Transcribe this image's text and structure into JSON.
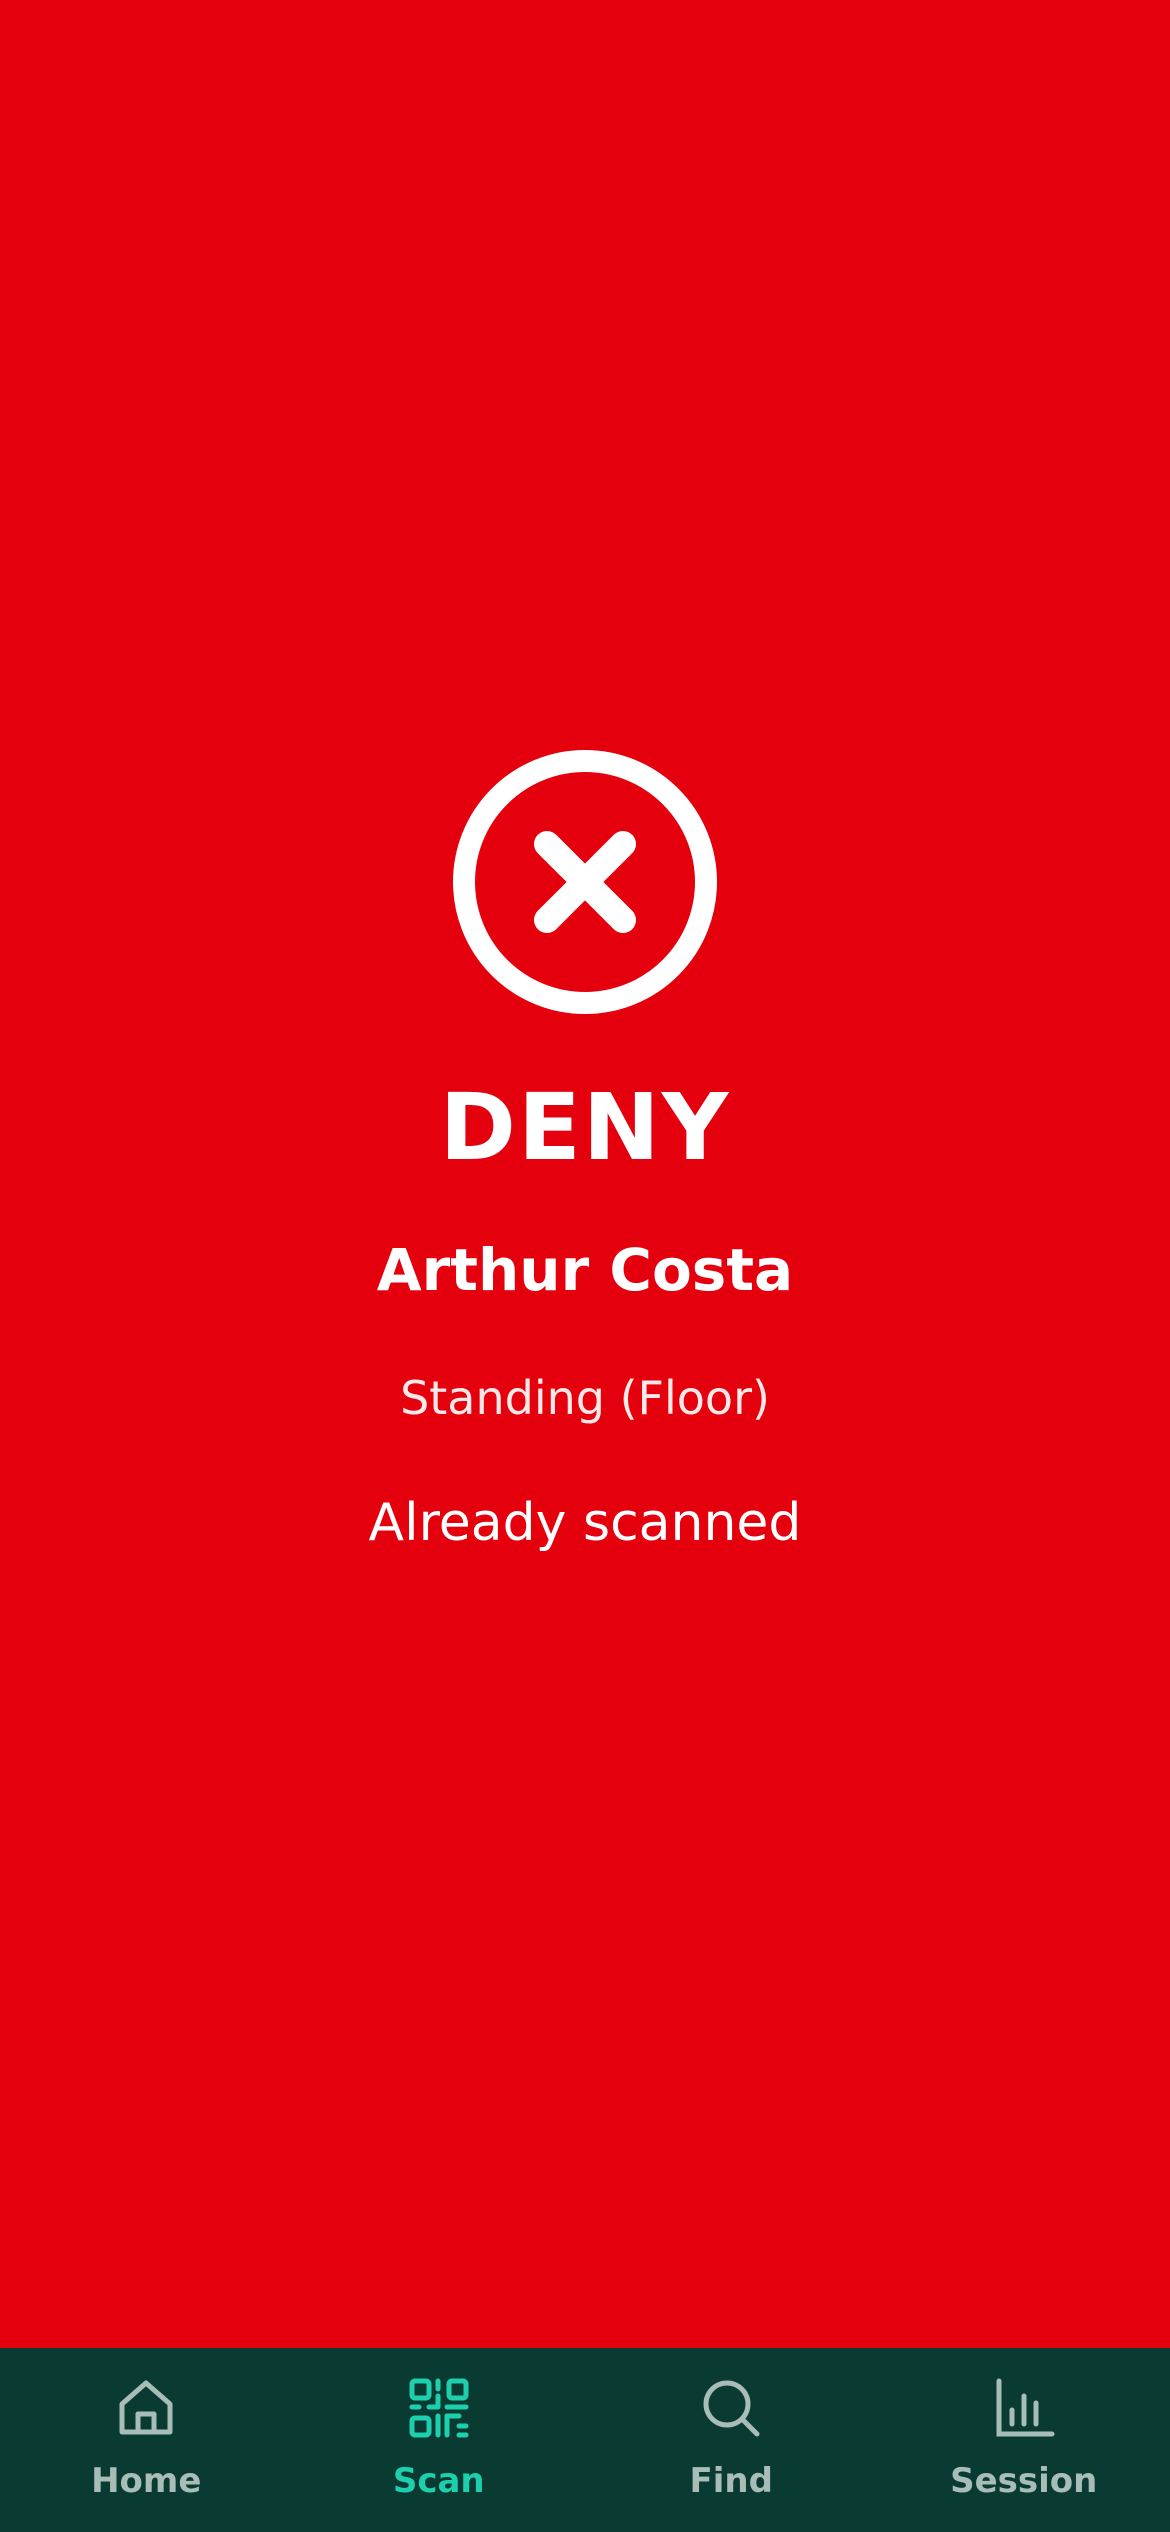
{
  "result": {
    "icon": "x-circle-icon",
    "status": "DENY",
    "name": "Arthur Costa",
    "ticket_type": "Standing (Floor)",
    "reason": "Already scanned"
  },
  "colors": {
    "deny_background": "#e5000d",
    "tabbar_background": "#0a3b33",
    "tab_active": "#1ecfad",
    "tab_inactive": "#a8bdb7"
  },
  "tabbar": {
    "active": "Scan",
    "tabs": [
      {
        "label": "Home",
        "icon": "home-icon"
      },
      {
        "label": "Scan",
        "icon": "qr-code-icon"
      },
      {
        "label": "Find",
        "icon": "search-icon"
      },
      {
        "label": "Session",
        "icon": "bar-chart-icon"
      }
    ]
  }
}
